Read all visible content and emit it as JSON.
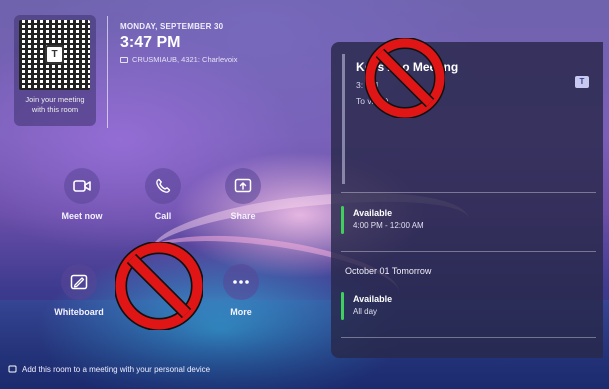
{
  "qr": {
    "center_glyph": "T",
    "caption": "Join your meeting with this room"
  },
  "header": {
    "date": "MONDAY, SEPTEMBER 30",
    "time": "3:47 PM",
    "room": "CRUSMIAUB, 4321: Charlevoix"
  },
  "actions": [
    {
      "label": "Meet now",
      "icon": "video-camera-icon"
    },
    {
      "label": "Call",
      "icon": "phone-icon"
    },
    {
      "label": "Share",
      "icon": "share-screen-icon"
    },
    {
      "label": "Whiteboard",
      "icon": "whiteboard-icon"
    },
    {
      "label": "More",
      "icon": "more-dots-icon"
    }
  ],
  "calendar": {
    "meeting": {
      "title": "Ke        's Zoo    Meeting",
      "time": "3:           PM",
      "organizer": "To       vin (         )"
    },
    "today_slots": [
      {
        "title": "Available",
        "sub": "4:00 PM - 12:00 AM"
      }
    ],
    "next_day_header": "October 01 Tomorrow",
    "tomorrow_slots": [
      {
        "title": "Available",
        "sub": "All day"
      }
    ],
    "status_color": "#3fcf5e"
  },
  "footer": {
    "text": "Add this room to a meeting with your personal device"
  },
  "overlay": {
    "prohibition_color": "#e01515"
  }
}
